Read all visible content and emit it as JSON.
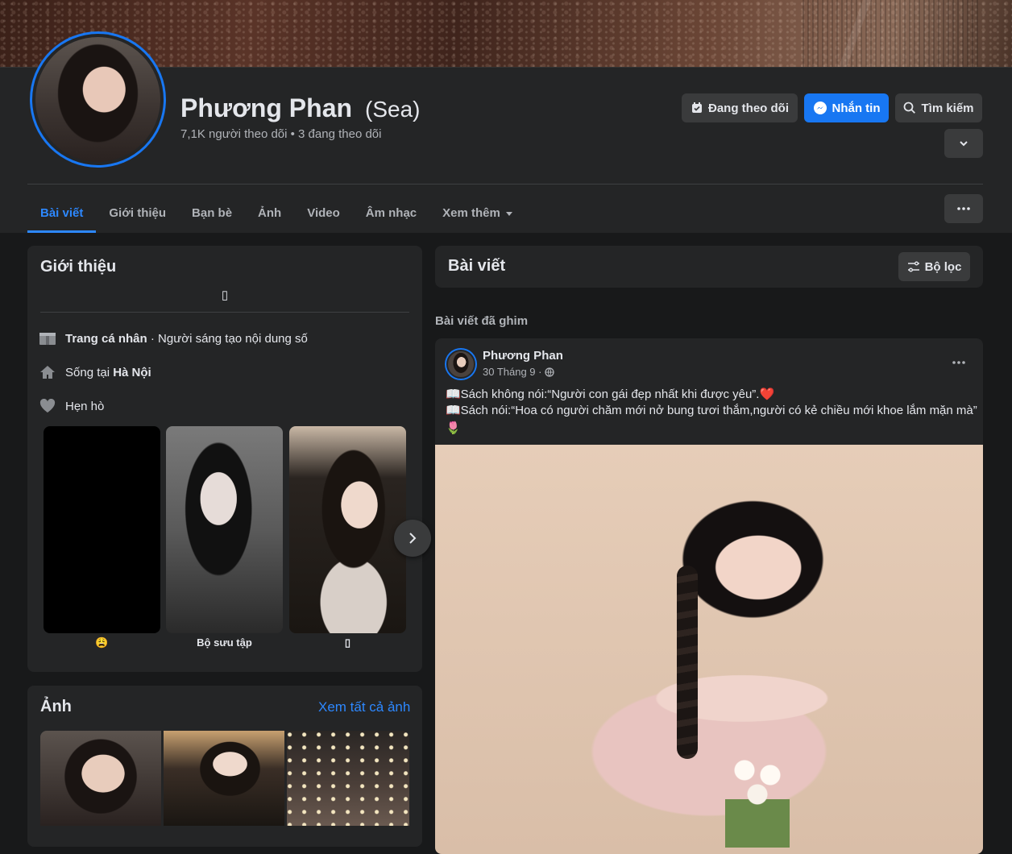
{
  "profile": {
    "name": "Phương Phan",
    "nickname": "(Sea)",
    "stats": "7,1K người theo dõi • 3 đang theo dõi"
  },
  "actions": {
    "following": "Đang theo dõi",
    "message": "Nhắn tin",
    "search": "Tìm kiếm"
  },
  "tabs": [
    {
      "label": "Bài viết"
    },
    {
      "label": "Giới thiệu"
    },
    {
      "label": "Bạn bè"
    },
    {
      "label": "Ảnh"
    },
    {
      "label": "Video"
    },
    {
      "label": "Âm nhạc"
    },
    {
      "label": "Xem thêm"
    }
  ],
  "intro": {
    "title": "Giới thiệu",
    "bio_glyph": "▯",
    "page_label": "Trang cá nhân",
    "page_category": " · Người sáng tạo nội dung số",
    "lives_prefix": "Sống tại ",
    "lives_city": "Hà Nội",
    "relationship": "Hẹn hò",
    "featured": [
      {
        "label": "😩"
      },
      {
        "label": "Bộ sưu tập"
      },
      {
        "label": "▯"
      }
    ]
  },
  "photos": {
    "title": "Ảnh",
    "see_all": "Xem tất cả ảnh"
  },
  "posts": {
    "title": "Bài viết",
    "filter": "Bộ lọc",
    "pinned_label": "Bài viết đã ghim",
    "pinned": {
      "author": "Phương Phan",
      "date": "30 Tháng 9 ·",
      "line1": "📖Sách không nói:“Người con gái đẹp nhất khi được yêu”.❤️",
      "line2": "📖Sách nói:“Hoa có người chăm mới nở bung tươi thắm,người có kẻ chiều mới khoe lắm mặn mà”",
      "line3": "🌷"
    }
  },
  "colors": {
    "accent": "#1877f2",
    "active_tab": "#2d88ff",
    "card_bg": "#242526",
    "page_bg": "#18191a"
  }
}
